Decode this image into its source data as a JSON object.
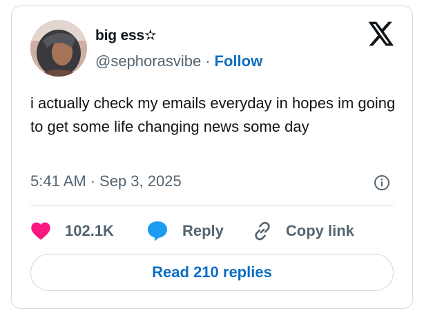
{
  "author": {
    "display_name": "big ess✫",
    "handle": "@sephorasvibe",
    "separator": "·",
    "follow_label": "Follow"
  },
  "tweet": {
    "text": "i actually check my emails everyday in hopes im going to get some life changing news some day",
    "time": "5:41 AM",
    "separator": "·",
    "date": "Sep 3, 2025"
  },
  "actions": {
    "like_count": "102.1K",
    "reply_label": "Reply",
    "copy_link_label": "Copy link"
  },
  "read_replies_label": "Read 210 replies",
  "icons": {
    "brand": "x-logo-icon",
    "info": "info-icon",
    "like": "heart-icon",
    "reply": "speech-bubble-icon",
    "copy": "link-icon"
  },
  "colors": {
    "like": "#f91880",
    "reply": "#1d9bf0",
    "link": "#0b6ec3",
    "secondary_text": "#536471",
    "primary_text": "#0f1419",
    "border": "#cfd9de"
  }
}
